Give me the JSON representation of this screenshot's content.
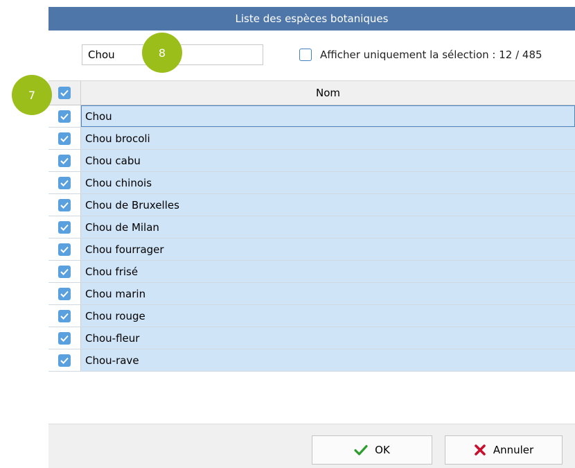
{
  "window": {
    "title": "Liste des espèces botaniques"
  },
  "search": {
    "value": "Chou"
  },
  "filter": {
    "label": "Afficher uniquement la sélection : 12 / 485",
    "checked": false
  },
  "grid": {
    "column_name": "Nom",
    "rows": [
      {
        "name": "Chou",
        "checked": true
      },
      {
        "name": "Chou brocoli",
        "checked": true
      },
      {
        "name": "Chou cabu",
        "checked": true
      },
      {
        "name": "Chou chinois",
        "checked": true
      },
      {
        "name": "Chou de Bruxelles",
        "checked": true
      },
      {
        "name": "Chou de Milan",
        "checked": true
      },
      {
        "name": "Chou fourrager",
        "checked": true
      },
      {
        "name": "Chou frisé",
        "checked": true
      },
      {
        "name": "Chou marin",
        "checked": true
      },
      {
        "name": "Chou rouge",
        "checked": true
      },
      {
        "name": "Chou-fleur",
        "checked": true
      },
      {
        "name": "Chou-rave",
        "checked": true
      }
    ]
  },
  "buttons": {
    "ok": "OK",
    "cancel": "Annuler"
  },
  "annotations": {
    "badge_7": "7",
    "badge_8": "8"
  },
  "colors": {
    "title_bar": "#4e76a8",
    "selection": "#cfe4f7",
    "checkbox": "#5a9fde",
    "badge": "#9bbe1a",
    "ok_icon": "#2e9c2e",
    "cancel_icon": "#c8102e"
  },
  "icons": {
    "ok": "checkmark-icon",
    "cancel": "cross-icon"
  }
}
